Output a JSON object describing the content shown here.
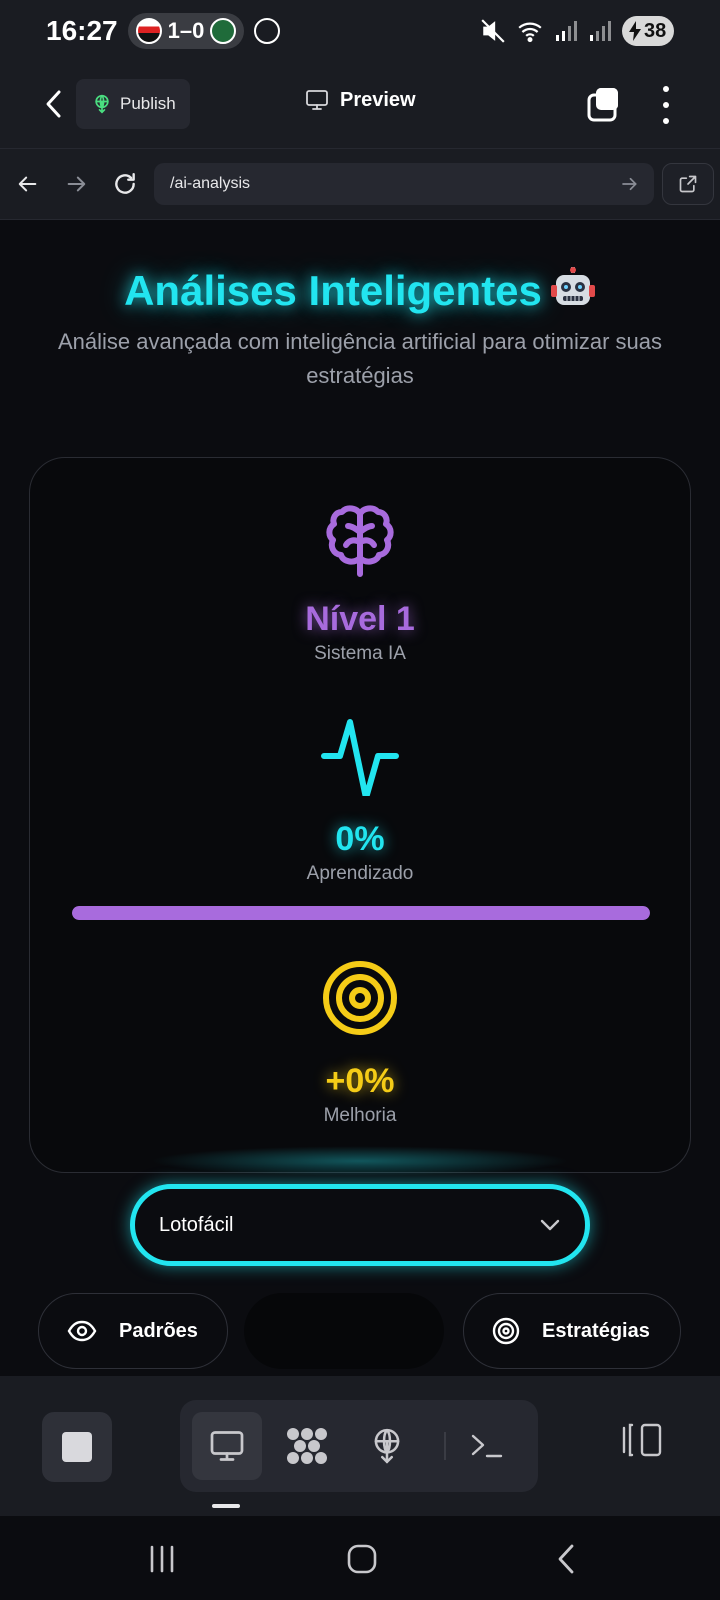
{
  "status": {
    "time": "16:27",
    "score": "1–0",
    "battery": "38"
  },
  "appbar": {
    "publish_label": "Publish",
    "preview_label": "Preview"
  },
  "urlbar": {
    "url": "/ai-analysis"
  },
  "page": {
    "title": "Análises Inteligentes",
    "subtitle": "Análise avançada com inteligência artificial para otimizar suas estratégias"
  },
  "stats": {
    "level": {
      "value": "Nível 1",
      "label": "Sistema IA",
      "icon": "brain-icon"
    },
    "learning": {
      "value": "0%",
      "label": "Aprendizado",
      "icon": "activity-icon",
      "progress_fraction": 1.0
    },
    "improvement": {
      "value": "+0%",
      "label": "Melhoria",
      "icon": "target-icon"
    }
  },
  "game_select": {
    "selected": "Lotofácil"
  },
  "tabs": {
    "patterns_label": "Padrões",
    "strategies_label": "Estratégias"
  },
  "colors": {
    "cyan": "#22e5f0",
    "purple": "#a86bdd",
    "yellow": "#f5cc17",
    "background": "#0b0c10"
  }
}
